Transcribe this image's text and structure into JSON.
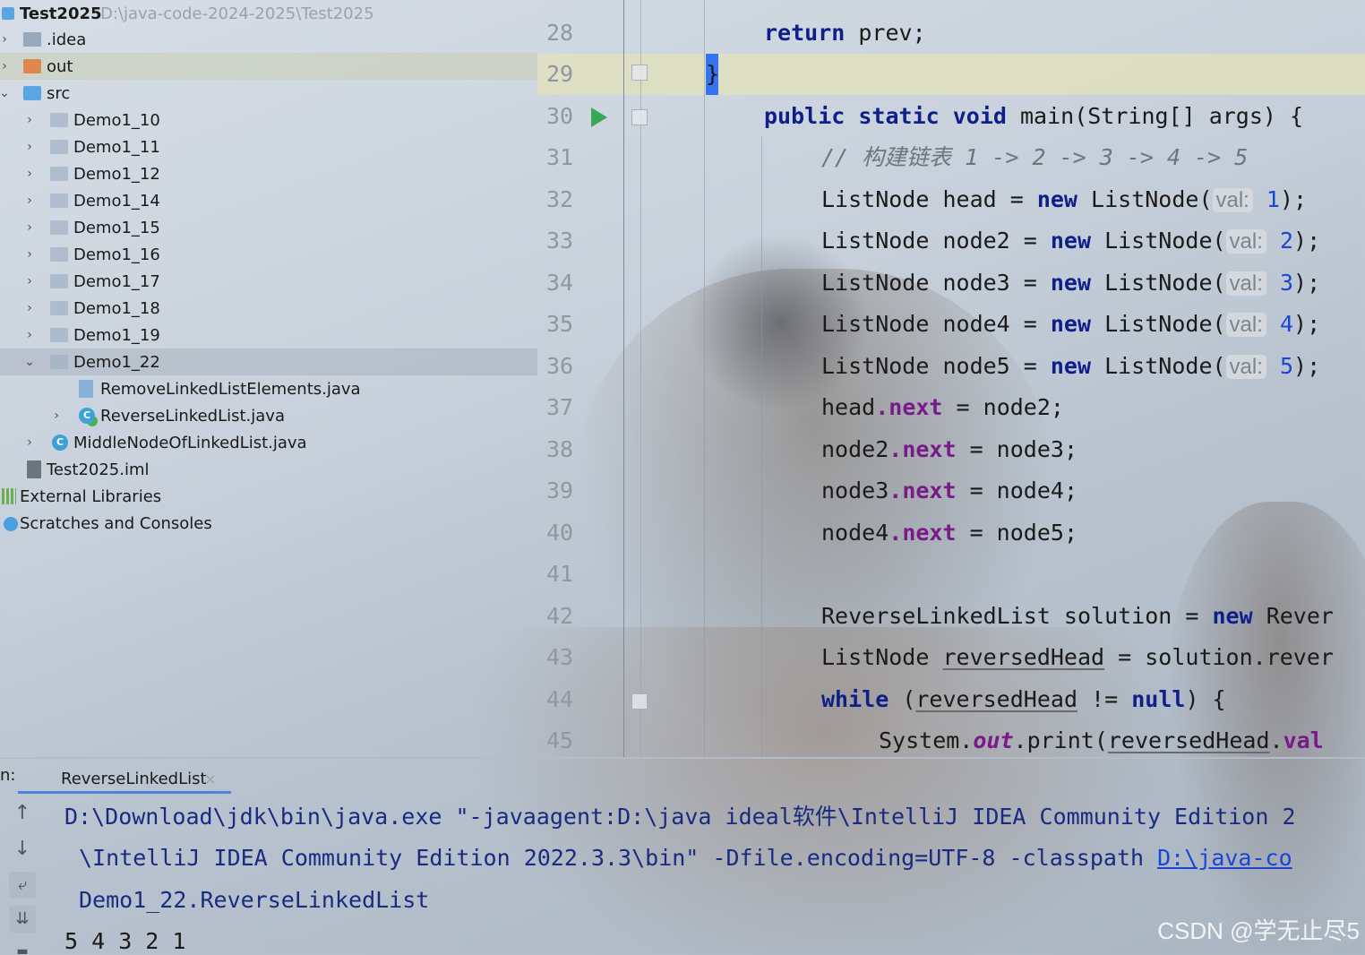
{
  "project": {
    "root_name": "Test2025",
    "root_path": "D:\\java-code-2024-2025\\Test2025",
    "items": [
      {
        "label": ".idea"
      },
      {
        "label": "out"
      },
      {
        "label": "src"
      },
      {
        "label": "Demo1_10"
      },
      {
        "label": "Demo1_11"
      },
      {
        "label": "Demo1_12"
      },
      {
        "label": "Demo1_14"
      },
      {
        "label": "Demo1_15"
      },
      {
        "label": "Demo1_16"
      },
      {
        "label": "Demo1_17"
      },
      {
        "label": "Demo1_18"
      },
      {
        "label": "Demo1_19"
      },
      {
        "label": "Demo1_22"
      },
      {
        "label": "RemoveLinkedListElements.java"
      },
      {
        "label": "ReverseLinkedList.java"
      },
      {
        "label": "MiddleNodeOfLinkedList.java"
      },
      {
        "label": "Test2025.iml"
      },
      {
        "label": "External Libraries"
      },
      {
        "label": "Scratches and Consoles"
      }
    ]
  },
  "editor": {
    "lines": [
      {
        "no": "28"
      },
      {
        "no": "29"
      },
      {
        "no": "30"
      },
      {
        "no": "31"
      },
      {
        "no": "32"
      },
      {
        "no": "33"
      },
      {
        "no": "34"
      },
      {
        "no": "35"
      },
      {
        "no": "36"
      },
      {
        "no": "37"
      },
      {
        "no": "38"
      },
      {
        "no": "39"
      },
      {
        "no": "40"
      },
      {
        "no": "41"
      },
      {
        "no": "42"
      },
      {
        "no": "43"
      },
      {
        "no": "44"
      },
      {
        "no": "45"
      }
    ],
    "code": {
      "l28_kw": "return",
      "l28_rest": " prev;",
      "l29": "}",
      "l30_kw": "public static void",
      "l30_rest": " main(String[] args) {",
      "l31": "// 构建链表 1 -> 2 -> 3 -> 4 -> 5",
      "node_decl": [
        "ListNode head = ",
        "ListNode node2 = ",
        "ListNode node3 = ",
        "ListNode node4 = ",
        "ListNode node5 = "
      ],
      "kw_new": "new",
      "ctor": " ListNode(",
      "hint_val": "val:",
      "vals": [
        "1",
        "2",
        "3",
        "4",
        "5"
      ],
      "close": ");",
      "links": [
        {
          "obj": "head",
          "rhs": " = node2;"
        },
        {
          "obj": "node2",
          "rhs": " = node3;"
        },
        {
          "obj": "node3",
          "rhs": " = node4;"
        },
        {
          "obj": "node4",
          "rhs": " = node5;"
        }
      ],
      "field_next": ".next",
      "l42_a": "ReverseLinkedList solution = ",
      "l42_b": " Rever",
      "l43_a": "ListNode ",
      "l43_var": "reversedHead",
      "l43_b": " = solution.rever",
      "l44_kw": "while",
      "l44_a": " (",
      "l44_var": "reversedHead",
      "l44_b": " != ",
      "l44_null": "null",
      "l44_c": ") {",
      "l45_a": "System.",
      "l45_out": "out",
      "l45_b": ".print(",
      "l45_var": "reversedHead",
      "l45_c": ".",
      "l45_val": "val"
    }
  },
  "run_panel": {
    "prefix": "n:",
    "tab_label": "ReverseLinkedList",
    "tab_close": "×",
    "console": {
      "line1": "D:\\Download\\jdk\\bin\\java.exe \"-javaagent:D:\\java ideal软件\\IntelliJ IDEA Community Edition 2",
      "line2_a": "\\IntelliJ IDEA Community Edition 2022.3.3\\bin\" -Dfile.encoding=UTF-8 -classpath ",
      "line2_link": "D:\\java-co",
      "line3": "Demo1_22.ReverseLinkedList",
      "output": "5 4 3 2 1"
    },
    "toolbar": {
      "up": "↑",
      "down": "↓",
      "wrap": "⤶",
      "scroll": "⇊",
      "more": "▬"
    }
  },
  "watermark": "CSDN @学无止尽5",
  "icons": {
    "folder": "folder-icon",
    "java-class": "java-class-icon",
    "run": "run-icon"
  }
}
